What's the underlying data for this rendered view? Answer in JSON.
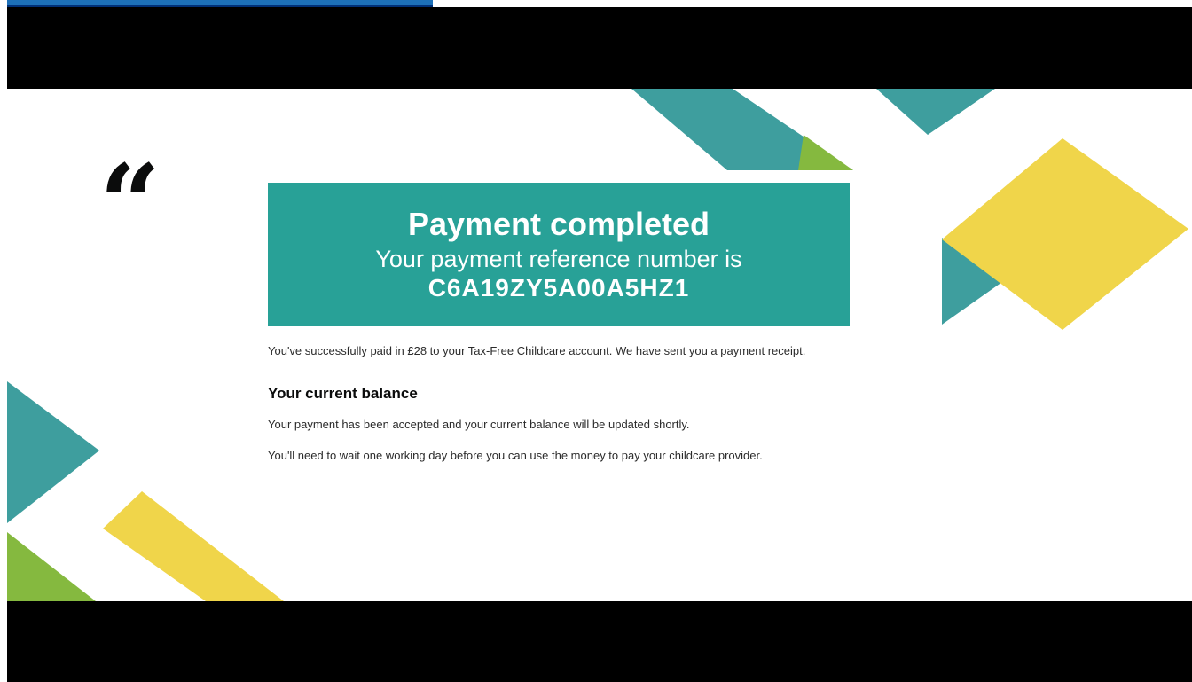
{
  "banner": {
    "title": "Payment completed",
    "reference_intro": "Your payment reference number is",
    "reference_number": "C6A19ZY5A00A5HZ1"
  },
  "quote_glyph": "“",
  "body": {
    "confirmation": "You've successfully paid in £28 to your Tax-Free Childcare account. We have sent you a payment receipt.",
    "balance_heading": "Your current balance",
    "balance_text": "Your payment has been accepted and your current balance will be updated shortly.",
    "wait_text": "You'll need to wait one working day before you can use the money to pay your childcare provider."
  },
  "colors": {
    "teal": "#28a197",
    "dark_teal": "#3e9e9e",
    "green": "#85b93f",
    "yellow": "#f0d54a",
    "letterbox": "#000000"
  }
}
